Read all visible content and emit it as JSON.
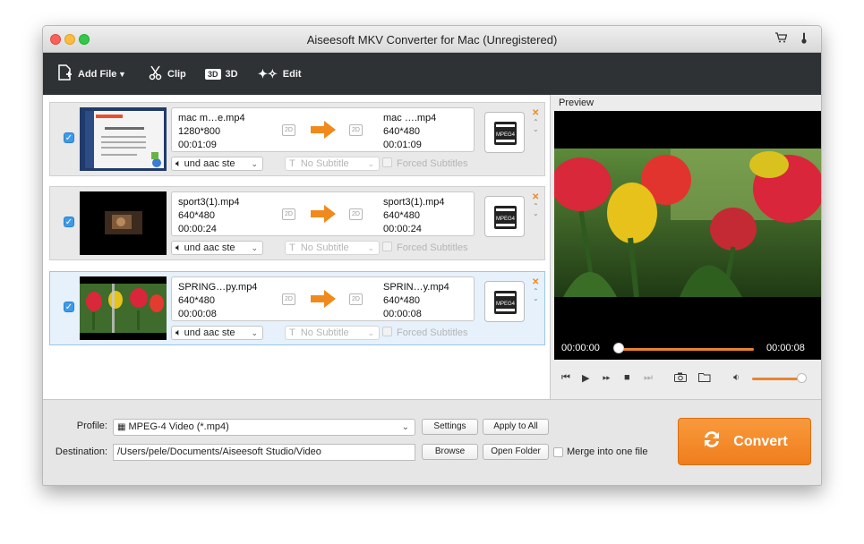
{
  "window": {
    "title": "Aiseesoft MKV Converter for Mac (Unregistered)"
  },
  "titlebar_icons": [
    "cart-icon",
    "thermometer-icon"
  ],
  "toolbar": {
    "add_file": "Add File",
    "clip": "Clip",
    "three_d_badge": "3D",
    "three_d": "3D",
    "edit": "Edit"
  },
  "items": [
    {
      "source": {
        "name": "mac m…e.mp4",
        "res": "1280*800",
        "dur": "00:01:09"
      },
      "target": {
        "name": "mac ….mp4",
        "res": "640*480",
        "dur": "00:01:09"
      },
      "audio": "und aac ste",
      "subtitle": "No Subtitle",
      "forced": "Forced Subtitles",
      "checked": true,
      "selected": false
    },
    {
      "source": {
        "name": "sport3(1).mp4",
        "res": "640*480",
        "dur": "00:00:24"
      },
      "target": {
        "name": "sport3(1).mp4",
        "res": "640*480",
        "dur": "00:00:24"
      },
      "audio": "und aac ste",
      "subtitle": "No Subtitle",
      "forced": "Forced Subtitles",
      "checked": true,
      "selected": false
    },
    {
      "source": {
        "name": "SPRING…py.mp4",
        "res": "640*480",
        "dur": "00:00:08"
      },
      "target": {
        "name": "SPRIN…y.mp4",
        "res": "640*480",
        "dur": "00:00:08"
      },
      "audio": "und aac ste",
      "subtitle": "No Subtitle",
      "forced": "Forced Subtitles",
      "checked": true,
      "selected": true
    }
  ],
  "twod_label": "2D",
  "profile_icon_label": "MPEG4",
  "preview": {
    "label": "Preview",
    "time_current": "00:00:00",
    "time_total": "00:00:08",
    "progress_fraction": 0.0,
    "volume_fraction": 0.95
  },
  "bottom": {
    "profile_label": "Profile:",
    "profile_value": "MPEG-4 Video (*.mp4)",
    "settings": "Settings",
    "apply_all": "Apply to All",
    "destination_label": "Destination:",
    "destination_value": "/Users/pele/Documents/Aiseesoft Studio/Video",
    "browse": "Browse",
    "open_folder": "Open Folder",
    "merge": "Merge into one file",
    "convert": "Convert"
  },
  "colors": {
    "accent": "#f07d1d",
    "checkbox": "#3d9ae8",
    "toolbar": "#2f3235"
  }
}
